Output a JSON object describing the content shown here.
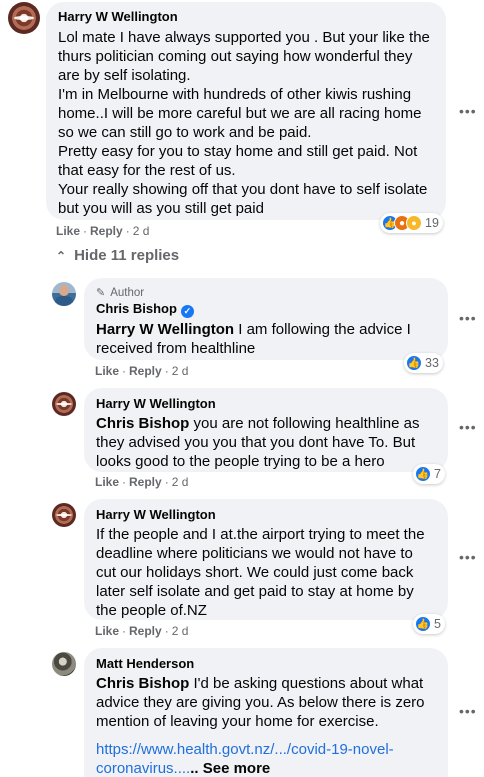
{
  "comments": {
    "c1": {
      "author": "Harry W Wellington",
      "text": "Lol mate I have always supported you . But your like the thurs politician coming out saying how wonderful they are by self isolating.\nI'm in Melbourne with hundreds of other kiwis rushing home..I will be more careful but we are all racing home so we can still go to work and be paid.\nPretty easy for you to stay home and still get paid. Not that easy for the rest of us.\nYour really showing off that you dont have to self isolate but you will as you still get paid",
      "like_label": "Like",
      "reply_label": "Reply",
      "time": "2 d",
      "reaction_count": "19"
    },
    "hide_replies_label": "Hide 11 replies",
    "r1": {
      "author_tag": "Author",
      "author": "Chris Bishop",
      "mention": "Harry W Wellington",
      "text": " I am following the advice I received from healthline",
      "like_label": "Like",
      "reply_label": "Reply",
      "time": "2 d",
      "reaction_count": "33"
    },
    "r2": {
      "author": "Harry W Wellington",
      "mention": "Chris Bishop",
      "text": " you are not following healthline as they advised you you that you dont have To. But looks good to the people trying to be a hero",
      "like_label": "Like",
      "reply_label": "Reply",
      "time": "2 d",
      "reaction_count": "7"
    },
    "r3": {
      "author": "Harry W Wellington",
      "text": "If the people and I at.the airport trying to meet the deadline where politicians we would not have to cut our holidays short. We could just come back later self isolate and get paid to stay at home by the people of.NZ",
      "like_label": "Like",
      "reply_label": "Reply",
      "time": "2 d",
      "reaction_count": "5"
    },
    "r4": {
      "author": "Matt Henderson",
      "mention": "Chris Bishop",
      "text": " I'd be asking questions about what advice they are giving you. As below there is zero mention of leaving your home for exercise.",
      "link": "https://www.health.govt.nz/.../covid-19-novel-coronavirus....",
      "see_more": ".. See more"
    }
  },
  "icons": {
    "more": "more-options-icon",
    "like_reaction": "like-reaction-icon",
    "angry_reaction": "angry-reaction-icon",
    "haha_reaction": "haha-reaction-icon",
    "verified": "verified-badge-icon",
    "pencil": "pencil-icon",
    "chevron": "chevron-up-icon"
  },
  "colors": {
    "bubble": "#f0f2f5",
    "link": "#216fdb",
    "like": "#1877f2",
    "muted": "#65676b"
  }
}
